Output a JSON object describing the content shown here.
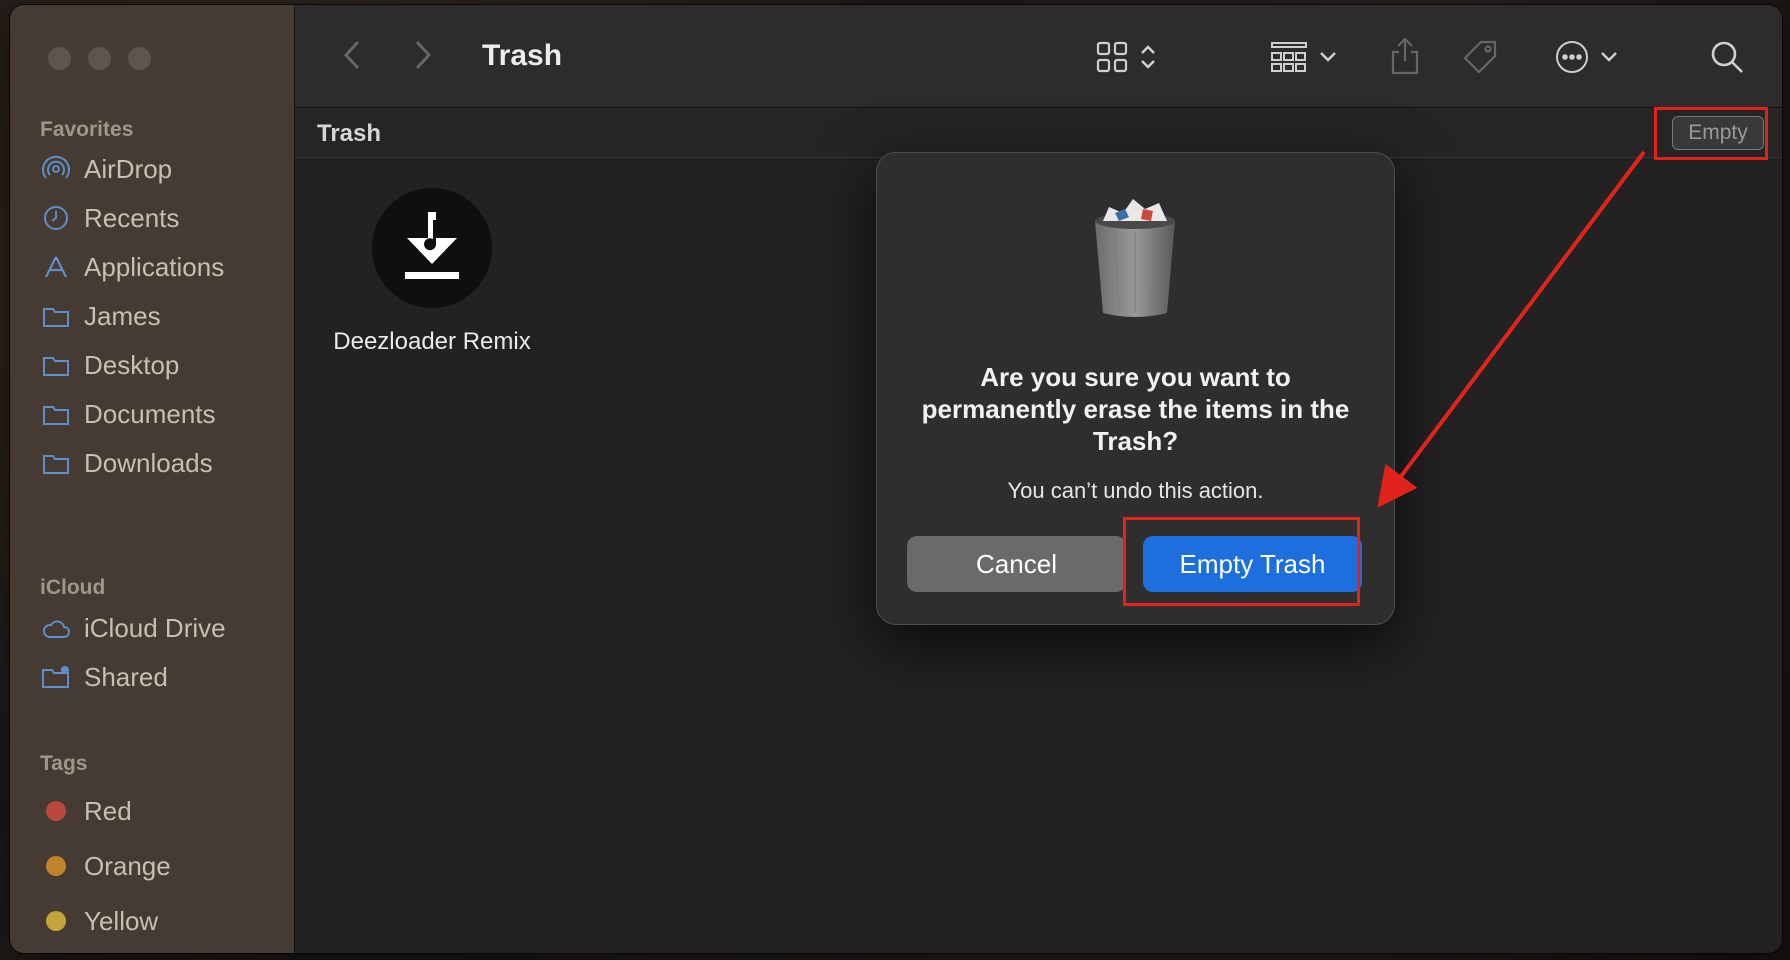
{
  "window": {
    "title": "Trash"
  },
  "sidebar": {
    "favorites_title": "Favorites",
    "favorites": [
      {
        "label": "AirDrop",
        "icon": "airdrop-icon"
      },
      {
        "label": "Recents",
        "icon": "clock-icon"
      },
      {
        "label": "Applications",
        "icon": "applications-icon"
      },
      {
        "label": "James",
        "icon": "folder-icon"
      },
      {
        "label": "Desktop",
        "icon": "folder-icon"
      },
      {
        "label": "Documents",
        "icon": "folder-icon"
      },
      {
        "label": "Downloads",
        "icon": "folder-icon"
      }
    ],
    "icloud_title": "iCloud",
    "icloud": [
      {
        "label": "iCloud Drive",
        "icon": "cloud-icon"
      },
      {
        "label": "Shared",
        "icon": "shared-folder-icon"
      }
    ],
    "tags_title": "Tags",
    "tags": [
      {
        "label": "Red",
        "color": "#b9483f"
      },
      {
        "label": "Orange",
        "color": "#c0852c"
      },
      {
        "label": "Yellow",
        "color": "#c2a43a"
      }
    ]
  },
  "pathbar": {
    "label": "Trash",
    "empty_button": "Empty"
  },
  "files": [
    {
      "name": "Deezloader Remix",
      "icon": "download-music-icon"
    }
  ],
  "dialog": {
    "title": "Are you sure you want to permanently erase the items in the Trash?",
    "subtitle": "You can’t undo this action.",
    "cancel": "Cancel",
    "confirm": "Empty Trash"
  },
  "colors": {
    "accent": "#1d6fde",
    "highlight": "#e0241c"
  }
}
